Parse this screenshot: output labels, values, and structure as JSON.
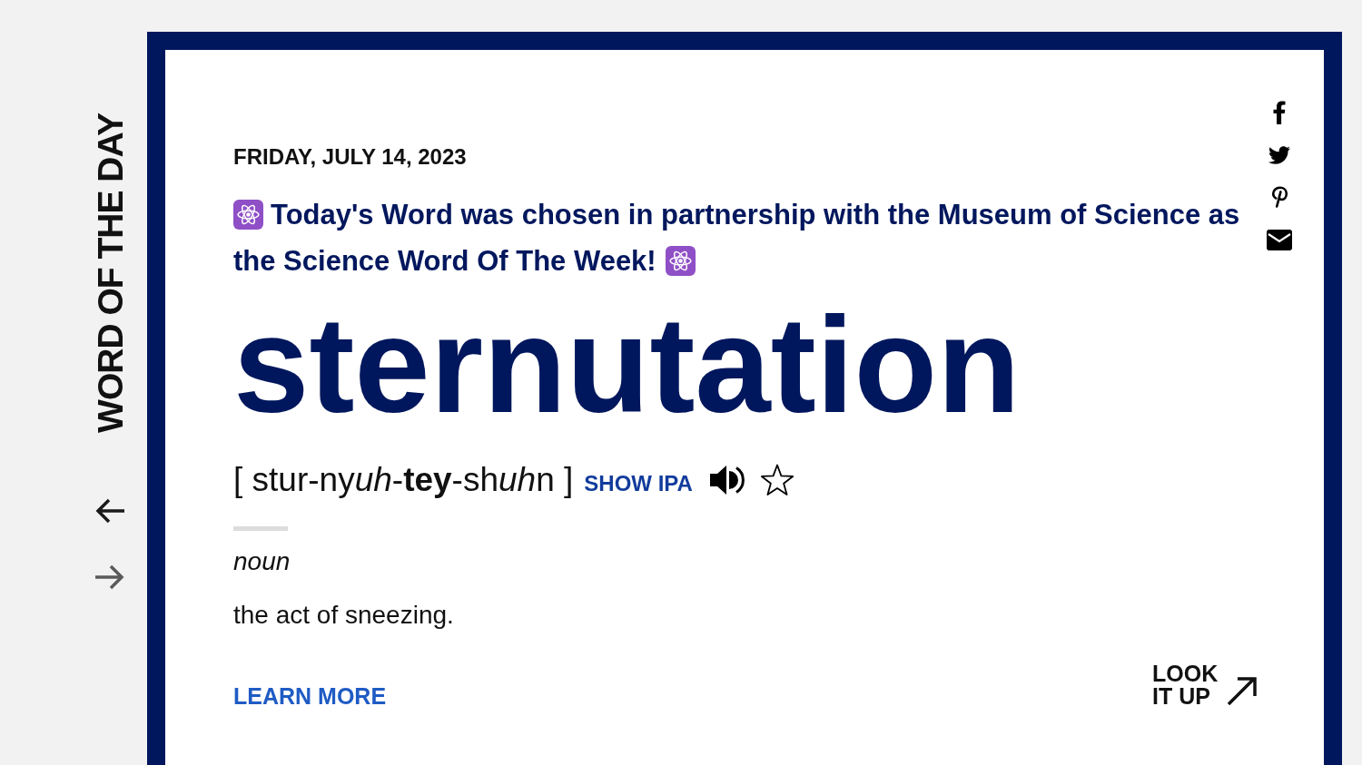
{
  "sidebar": {
    "title": "WORD OF THE DAY",
    "nav_arrows": [
      {
        "kind": "previous",
        "disabled": false
      },
      {
        "kind": "next",
        "disabled": true
      }
    ]
  },
  "card": {
    "date": "FRIDAY, JULY 14, 2023",
    "banner": "Today's Word was chosen in partnership with the Museum of Science as the Science Word Of The Week!",
    "word": "sternutation",
    "pronunciation": [
      {
        "kind": "plain",
        "text": "[ stur-ny"
      },
      {
        "kind": "italic",
        "text": "uh"
      },
      {
        "kind": "plain",
        "text": "-"
      },
      {
        "kind": "bold",
        "text": "tey"
      },
      {
        "kind": "plain",
        "text": "-sh"
      },
      {
        "kind": "italic",
        "text": "uh"
      },
      {
        "kind": "plain",
        "text": "n ]"
      }
    ],
    "show_ipa": "SHOW IPA",
    "saved": false,
    "part_of_speech": "noun",
    "definition": "the act of sneezing.",
    "learn_more": "LEARN MORE",
    "look_it_up": "LOOK IT UP"
  }
}
